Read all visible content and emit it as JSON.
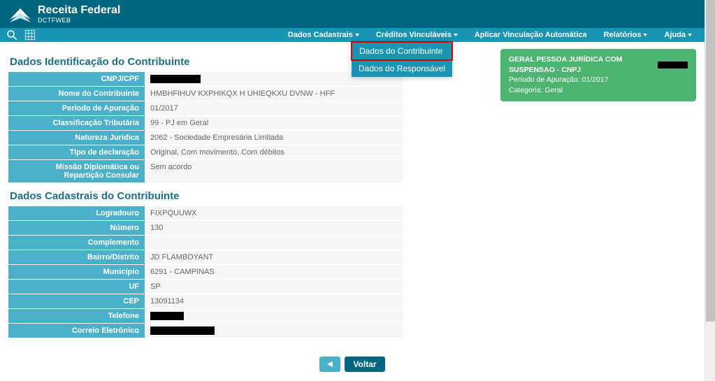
{
  "brand": {
    "title": "Receita Federal",
    "sub": "DCTFWEB"
  },
  "menu": {
    "dados_cadastrais": "Dados Cadastrais",
    "creditos_vinculaveis": "Créditos Vinculáveis",
    "aplicar_vinculacao": "Aplicar Vinculação Automática",
    "relatorios": "Relatórios",
    "ajuda": "Ajuda"
  },
  "dropdown": {
    "contribuinte": "Dados do Contribuinte",
    "responsavel": "Dados do Responsável"
  },
  "info": {
    "line1": "GERAL PESSOA JURÍDICA COM SUSPENSAO - CNPJ",
    "line2": "Período de Apuração: 01/2017",
    "line3": "Categoria: Geral"
  },
  "section1_title": "Dados Identificação do Contribuinte",
  "section1": [
    {
      "label": "CNPJ/CPF",
      "value": "",
      "redacted_width": 72
    },
    {
      "label": "Nome do Contribuinte",
      "value": "HMBHFIHUV KXPHIKQX H UHIEQKXU DVNW - HFF"
    },
    {
      "label": "Período de Apuração",
      "value": "01/2017"
    },
    {
      "label": "Classificação Tributária",
      "value": "99 - PJ em Geral"
    },
    {
      "label": "Natureza Jurídica",
      "value": "2062 - Sociedade Empresária Limitada"
    },
    {
      "label": "Tipo de declaração",
      "value": "Original, Com movimento, Com débitos"
    },
    {
      "label": "Missão Diplomática ou Repartição Consular",
      "value": "Sem acordo"
    }
  ],
  "section2_title": "Dados Cadastrais do Contribuinte",
  "section2": [
    {
      "label": "Logradouro",
      "value": "FIXPQUUWX"
    },
    {
      "label": "Número",
      "value": "130"
    },
    {
      "label": "Complemento",
      "value": ""
    },
    {
      "label": "Bairro/Distrito",
      "value": "JD FLAMBOYANT"
    },
    {
      "label": "Município",
      "value": "6291 - CAMPINAS"
    },
    {
      "label": "UF",
      "value": "SP"
    },
    {
      "label": "CEP",
      "value": "13091134"
    },
    {
      "label": "Telefone",
      "value": "",
      "redacted_width": 48
    },
    {
      "label": "Correio Eletrônico",
      "value": "",
      "redacted_width": 92
    }
  ],
  "buttons": {
    "voltar": "Voltar"
  }
}
